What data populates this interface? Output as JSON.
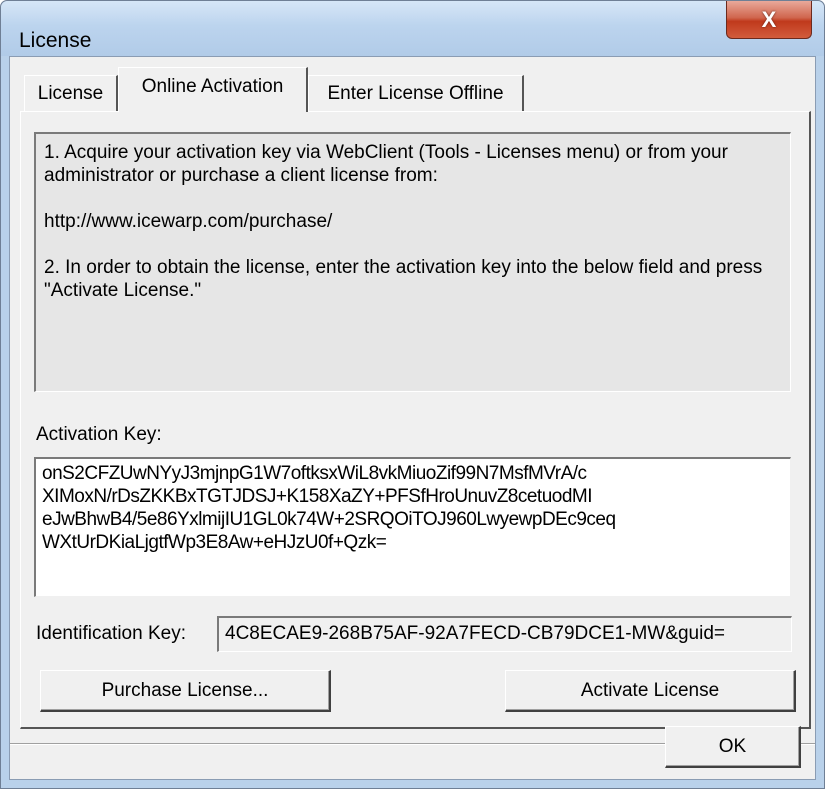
{
  "window": {
    "title": "License",
    "close_label": "X"
  },
  "tabs": [
    {
      "label": "License",
      "active": false
    },
    {
      "label": "Online Activation",
      "active": true
    },
    {
      "label": "Enter License Offline",
      "active": false
    }
  ],
  "instructions": {
    "line1": "1. Acquire your activation key via WebClient (Tools - Licenses menu) or from your administrator or purchase a client license from:",
    "url": "http://www.icewarp.com/purchase/",
    "line2": "2. In order to obtain the license, enter the activation key into the below field and press \"Activate License.\""
  },
  "activation_key": {
    "label": "Activation Key:",
    "value": "onS2CFZUwNYyJ3mjnpG1W7oftksxWiL8vkMiuoZif99N7MsfMVrA/c\nXIMoxN/rDsZKKBxTGTJDSJ+K158XaZY+PFSfHroUnuvZ8cetuodMI\neJwBhwB4/5e86YxlmijIU1GL0k74W+2SRQOiTOJ960LwyewpDEc9ceq\nWXtUrDKiaLjgtfWp3E8Aw+eHJzU0f+Qzk="
  },
  "identification_key": {
    "label": "Identification Key:",
    "value": "4C8ECAE9-268B75AF-92A7FECD-CB79DCE1-MW&guid="
  },
  "buttons": {
    "purchase": "Purchase License...",
    "activate": "Activate License",
    "ok": "OK"
  },
  "colors": {
    "frame": "#b9d1ea",
    "dialog_bg": "#f0f0f0",
    "close_button": "#c0391c"
  }
}
